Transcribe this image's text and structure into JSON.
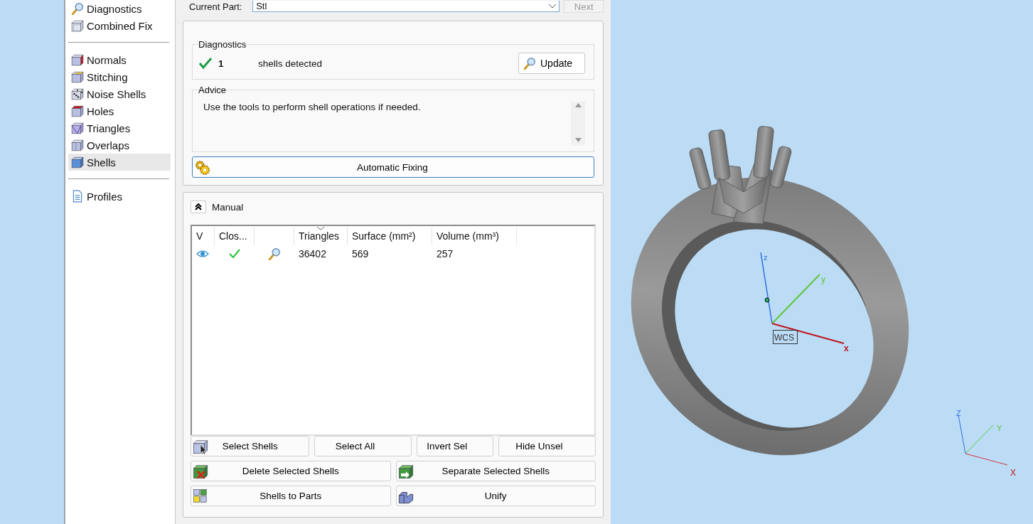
{
  "sidebar": {
    "groups": [
      {
        "items": [
          {
            "label": "Diagnostics",
            "selected": false
          },
          {
            "label": "Combined Fix",
            "selected": false
          }
        ]
      },
      {
        "items": [
          {
            "label": "Normals",
            "selected": false
          },
          {
            "label": "Stitching",
            "selected": false
          },
          {
            "label": "Noise Shells",
            "selected": false
          },
          {
            "label": "Holes",
            "selected": false
          },
          {
            "label": "Triangles",
            "selected": false
          },
          {
            "label": "Overlaps",
            "selected": false
          },
          {
            "label": "Shells",
            "selected": true
          }
        ]
      },
      {
        "items": [
          {
            "label": "Profiles",
            "selected": false
          }
        ]
      }
    ]
  },
  "part_selector": {
    "label": "Current Part:",
    "value": "Stl"
  },
  "next_button": {
    "label": "Next",
    "disabled": true
  },
  "diagnostics": {
    "title": "Diagnostics",
    "ok": true,
    "count": "1",
    "message": "shells detected",
    "update_button": "Update"
  },
  "advice": {
    "title": "Advice",
    "text": "Use the tools to perform shell operations if needed."
  },
  "auto_fix_button": {
    "label": "Automatic Fixing"
  },
  "manual": {
    "title": "Manual",
    "expanded": true,
    "table": {
      "columns": [
        {
          "label": "V",
          "sorted": false
        },
        {
          "label": "Clos...",
          "sorted": false
        },
        {
          "sorted": false
        },
        {
          "label": "Triangles",
          "sorted": true
        },
        {
          "label": "Surface (mm²)",
          "sorted": false
        },
        {
          "label": "Volume (mm³)",
          "sorted": false
        }
      ],
      "rows": [
        {
          "visible": true,
          "closed": true,
          "triangles": "36402",
          "surface": "569",
          "volume": "257"
        }
      ]
    },
    "buttons": [
      [
        {
          "label": "Select Shells",
          "kind": "select"
        },
        {
          "label": "Select All",
          "kind": "plain"
        },
        {
          "label": "Invert Sel",
          "kind": "plain"
        },
        {
          "label": "Hide Unsel",
          "kind": "plain"
        }
      ],
      [
        {
          "label": "Delete Selected Shells",
          "kind": "delete"
        },
        {
          "label": "Separate Selected Shells",
          "kind": "separate"
        }
      ],
      [
        {
          "label": "Shells to Parts",
          "kind": "parts"
        },
        {
          "label": "Unify",
          "kind": "unify"
        }
      ]
    ]
  },
  "viewport": {
    "wcs_label": "WCS",
    "wcs_axes": {
      "x": "x",
      "y": "y",
      "z": "z"
    },
    "triad_axes": {
      "x": "X",
      "y": "Y",
      "z": "Z"
    }
  }
}
